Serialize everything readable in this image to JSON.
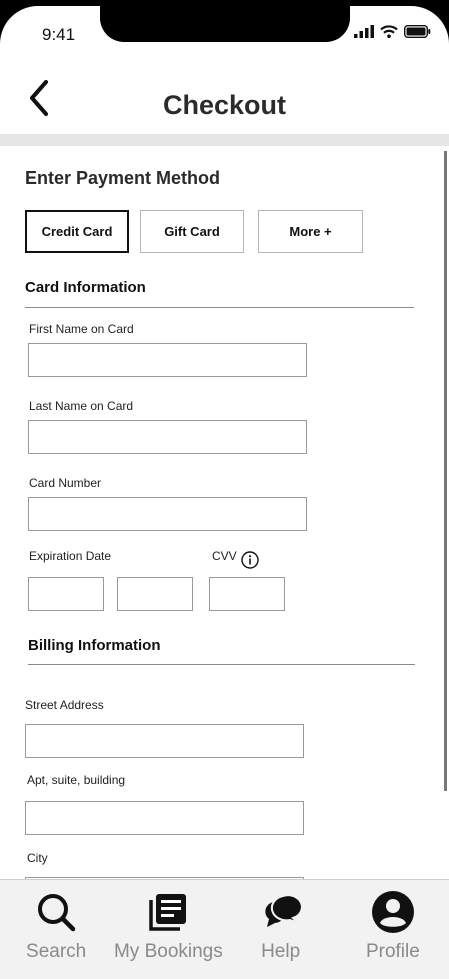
{
  "status_bar": {
    "time": "9:41"
  },
  "header": {
    "title": "Checkout"
  },
  "payment": {
    "heading": "Enter Payment Method",
    "methods": [
      {
        "label": "Credit Card",
        "active": true
      },
      {
        "label": "Gift Card",
        "active": false
      },
      {
        "label": "More +",
        "active": false
      }
    ]
  },
  "card_info": {
    "heading": "Card Information",
    "first_name_label": "First Name on Card",
    "first_name_value": "",
    "last_name_label": "Last Name on Card",
    "last_name_value": "",
    "card_number_label": "Card Number",
    "card_number_value": "",
    "expiration_label": "Expiration Date",
    "exp_month_value": "",
    "exp_year_value": "",
    "cvv_label": "CVV",
    "cvv_value": ""
  },
  "billing": {
    "heading": "Billing Information",
    "street_label": "Street Address",
    "street_value": "",
    "apt_label": "Apt, suite, building",
    "apt_value": "",
    "city_label": "City",
    "city_value": ""
  },
  "tab_bar": {
    "items": [
      {
        "label": "Search",
        "icon": "search-icon"
      },
      {
        "label": "My Bookings",
        "icon": "bookings-icon"
      },
      {
        "label": "Help",
        "icon": "chat-bubbles-icon"
      },
      {
        "label": "Profile",
        "icon": "profile-icon"
      }
    ]
  }
}
